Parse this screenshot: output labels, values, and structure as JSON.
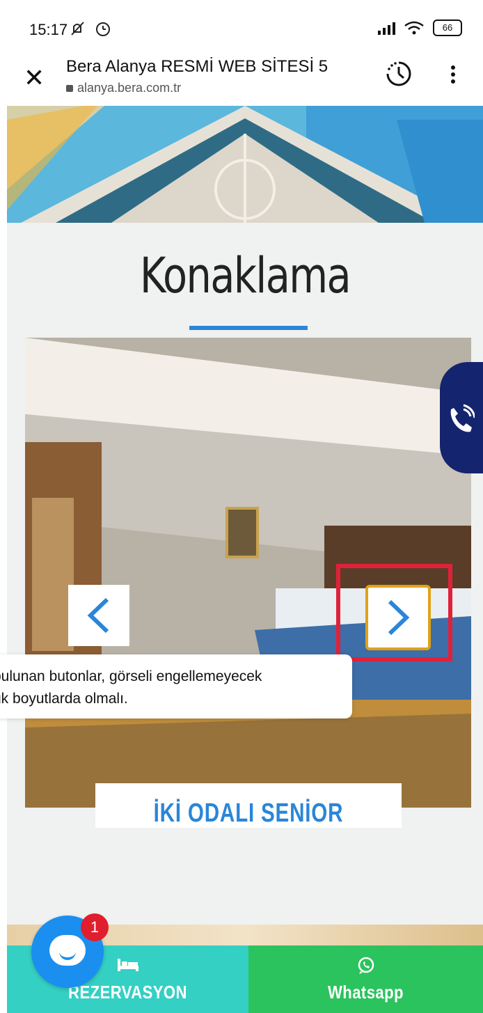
{
  "status_bar": {
    "time": "15:17",
    "battery": "66"
  },
  "browser": {
    "title": "Bera Alanya RESMİ WEB SİTESİ 5",
    "url": "alanya.bera.com.tr"
  },
  "page": {
    "heading": "Konaklama",
    "tooltip_line1": "bulunan butonlar, görseli engellemeyecek",
    "tooltip_line2": "ük boyutlarda olmalı.",
    "room_label": "İKİ ODALI SENİOR SUİT"
  },
  "bottom_bar": {
    "reservation_label": "REZERVASYON",
    "whatsapp_label": "Whatsapp"
  },
  "chat": {
    "badge_count": "1"
  },
  "colors": {
    "accent_blue": "#2a86d8",
    "highlight_red": "#e0213a",
    "reservation_teal": "#34d0c4",
    "whatsapp_green": "#2bc35d",
    "call_tab_navy": "#15246e"
  }
}
